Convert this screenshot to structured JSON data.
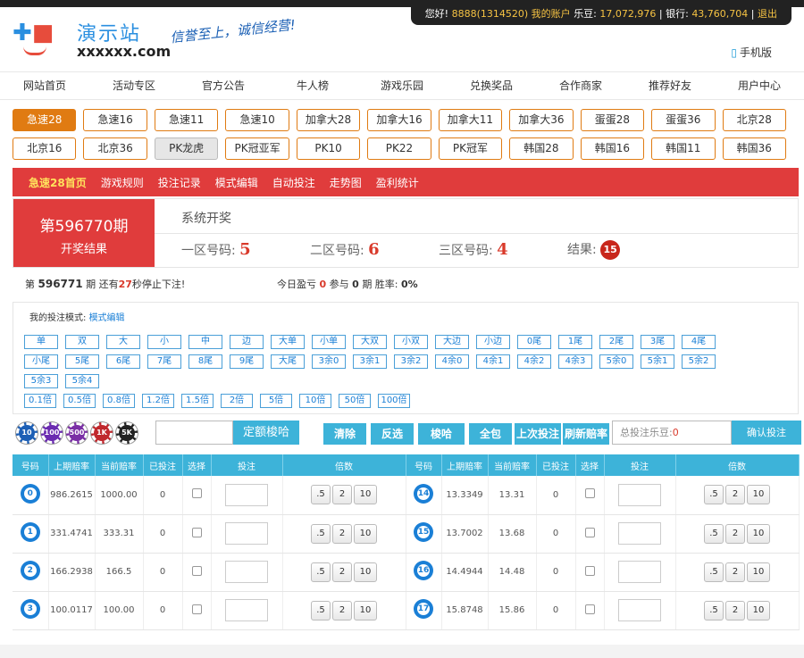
{
  "top": {
    "greeting": "您好!",
    "account": "8888(1314520) 我的账户",
    "ledou_label": "乐豆:",
    "ledou": "17,072,976",
    "bank_label": "银行:",
    "bank": "43,760,704",
    "logout": "退出"
  },
  "logo": {
    "name": "演示站",
    "domain": "xxxxxx.com",
    "slogan": "信誉至上，诚信经营!"
  },
  "mobile": "手机版",
  "nav": [
    "网站首页",
    "活动专区",
    "官方公告",
    "牛人榜",
    "游戏乐园",
    "兑换奖品",
    "合作商家",
    "推荐好友",
    "用户中心"
  ],
  "games_row1": [
    "急速28",
    "急速16",
    "急速11",
    "急速10",
    "加拿大28",
    "加拿大16",
    "加拿大11",
    "加拿大36",
    "蛋蛋28",
    "蛋蛋36",
    "北京28"
  ],
  "games_row2": [
    "北京16",
    "北京36",
    "PK龙虎",
    "PK冠亚军",
    "PK10",
    "PK22",
    "PK冠军",
    "韩国28",
    "韩国16",
    "韩国11",
    "韩国36"
  ],
  "subnav": [
    "急速28首页",
    "游戏规则",
    "投注记录",
    "模式编辑",
    "自动投注",
    "走势图",
    "盈利统计"
  ],
  "result": {
    "issue": "第596770期",
    "label": "开奖结果",
    "sys": "系统开奖",
    "z1_label": "一区号码:",
    "z1": "5",
    "z2_label": "二区号码:",
    "z2": "6",
    "z3_label": "三区号码:",
    "z3": "4",
    "res_label": "结果:",
    "res": "15"
  },
  "status": {
    "p1": "第",
    "issue": "596771",
    "p2": "期 还有",
    "secs": "27",
    "p3": "秒停止下注!",
    "t1": "今日盈亏",
    "profit": "0",
    "t2": "参与",
    "count": "0",
    "t3": "期 胜率:",
    "rate": "0%"
  },
  "mode": {
    "title": "我的投注模式:",
    "edit": "模式编辑",
    "row1": [
      "单",
      "双",
      "大",
      "小",
      "中",
      "边",
      "大单",
      "小单",
      "大双",
      "小双",
      "大边",
      "小边",
      "0尾",
      "1尾",
      "2尾",
      "3尾",
      "4尾"
    ],
    "row2": [
      "小尾",
      "5尾",
      "6尾",
      "7尾",
      "8尾",
      "9尾",
      "大尾",
      "3余0",
      "3余1",
      "3余2",
      "4余0",
      "4余1",
      "4余2",
      "4余3",
      "5余0",
      "5余1",
      "5余2"
    ],
    "row3": [
      "5余3",
      "5余4"
    ],
    "row4": [
      "0.1倍",
      "0.5倍",
      "0.8倍",
      "1.2倍",
      "1.5倍",
      "2倍",
      "5倍",
      "10倍",
      "50倍",
      "100倍"
    ]
  },
  "chips": [
    {
      "label": "10",
      "color": "#1d5fb5"
    },
    {
      "label": "100",
      "color": "#6a2bb0"
    },
    {
      "label": "500",
      "color": "#7a2fa5"
    },
    {
      "label": "1K",
      "color": "#c0282d"
    },
    {
      "label": "5K",
      "color": "#222222"
    }
  ],
  "actions": {
    "fixed": "定额梭哈",
    "clear": "清除",
    "invert": "反选",
    "allin": "梭哈",
    "all": "全包",
    "last": "上次投注",
    "refresh": "刷新赔率",
    "total_label": "总投注乐豆:",
    "total": "0",
    "confirm": "确认投注"
  },
  "table": {
    "headers": [
      "号码",
      "上期赔率",
      "当前赔率",
      "已投注",
      "选择",
      "投注",
      "倍数"
    ],
    "mult": [
      ".5",
      "2",
      "10"
    ],
    "left": [
      {
        "num": "0",
        "prev": "986.2615",
        "cur": "1000.00",
        "bet": "0"
      },
      {
        "num": "1",
        "prev": "331.4741",
        "cur": "333.31",
        "bet": "0"
      },
      {
        "num": "2",
        "prev": "166.2938",
        "cur": "166.5",
        "bet": "0"
      },
      {
        "num": "3",
        "prev": "100.0117",
        "cur": "100.00",
        "bet": "0"
      }
    ],
    "right": [
      {
        "num": "14",
        "prev": "13.3349",
        "cur": "13.31",
        "bet": "0"
      },
      {
        "num": "15",
        "prev": "13.7002",
        "cur": "13.68",
        "bet": "0"
      },
      {
        "num": "16",
        "prev": "14.4944",
        "cur": "14.48",
        "bet": "0"
      },
      {
        "num": "17",
        "prev": "15.8748",
        "cur": "15.86",
        "bet": "0"
      }
    ]
  }
}
